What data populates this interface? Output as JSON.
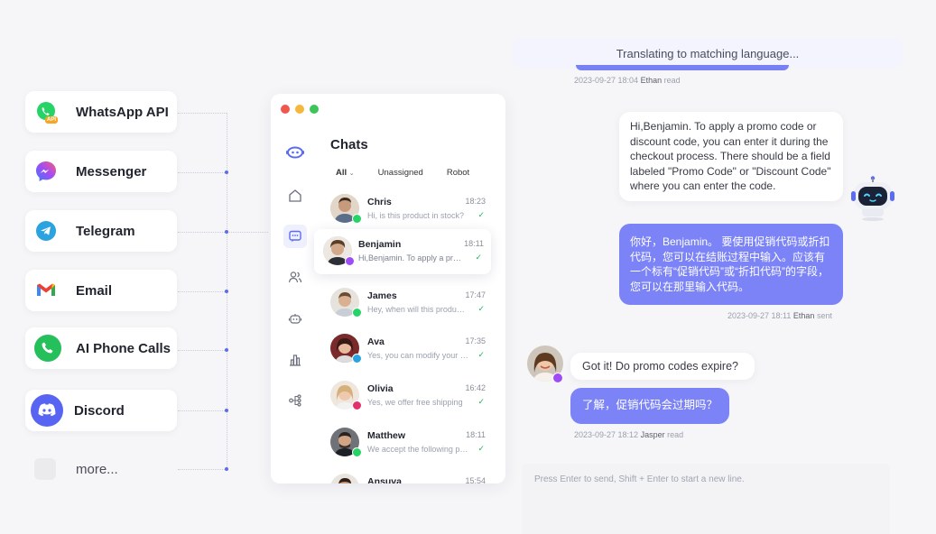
{
  "channels": [
    {
      "label": "WhatsApp API",
      "icon": "whatsapp-icon",
      "badge": "API"
    },
    {
      "label": "Messenger",
      "icon": "messenger-icon"
    },
    {
      "label": "Telegram",
      "icon": "telegram-icon"
    },
    {
      "label": "Email",
      "icon": "gmail-icon"
    },
    {
      "label": "AI Phone Calls",
      "icon": "phone-icon"
    },
    {
      "label": "Discord",
      "icon": "discord-icon"
    },
    {
      "label": "more...",
      "icon": "more-icon"
    }
  ],
  "window": {
    "traffic_colors": [
      "#f0584f",
      "#f5b83a",
      "#3dc55a"
    ],
    "rail_icons": [
      "logo-icon",
      "home-icon",
      "chat-icon",
      "contacts-icon",
      "bot-icon",
      "analytics-icon",
      "flow-icon"
    ],
    "chats_title": "Chats",
    "filters": [
      "All",
      "Unassigned",
      "Robot"
    ],
    "chats": [
      {
        "name": "Chris",
        "time": "18:23",
        "preview": "Hi, is this product in stock?",
        "channel": "whatsapp",
        "check": "✓"
      },
      {
        "name": "Benjamin",
        "time": "18:11",
        "preview": "Hi,Benjamin. To apply a promo code",
        "channel": "messenger",
        "check": "✓"
      },
      {
        "name": "James",
        "time": "17:47",
        "preview": "Hey, when will this product ship?",
        "channel": "whatsapp",
        "check": "✓"
      },
      {
        "name": "Ava",
        "time": "17:35",
        "preview": "Yes, you can modify your order",
        "channel": "telegram",
        "check": "✓"
      },
      {
        "name": "Olivia",
        "time": "16:42",
        "preview": "Yes, we offer free shipping",
        "channel": "instagram",
        "check": "✓"
      },
      {
        "name": "Matthew",
        "time": "18:11",
        "preview": "We accept the following payments",
        "channel": "whatsapp",
        "check": "✓"
      },
      {
        "name": "Ansuva",
        "time": "15:54",
        "preview": "",
        "channel": "",
        "check": ""
      }
    ]
  },
  "conversation": {
    "translating": "Translating to matching language...",
    "meta1": {
      "time": "2023-09-27 18:04",
      "who": "Ethan",
      "status": "read"
    },
    "bot_message": "Hi,Benjamin. To apply a promo code or discount code, you can enter it during the checkout process. There should be a field labeled \"Promo Code\" or \"Discount Code\" where you can enter the code.",
    "translated_message": "你好，Benjamin。 要使用促销代码或折扣代码，您可以在结账过程中输入。应该有一个标有“促销代码”或“折扣代码”的字段，您可以在那里输入代码。",
    "meta2": {
      "time": "2023-09-27 18:11",
      "who": "Ethan",
      "status": "sent"
    },
    "customer_message": "Got it! Do promo codes expire?",
    "customer_translated": "了解，促销代码会过期吗？",
    "meta3": {
      "time": "2023-09-27 18:12",
      "who": "Jasper",
      "status": "read"
    },
    "input_placeholder": "Press Enter to send,  Shift + Enter to start a new line."
  },
  "colors": {
    "accent": "#7b83f6",
    "whatsapp": "#25d366",
    "messenger": "#a04cf5",
    "telegram": "#2aa3e0",
    "discord": "#5865f2"
  }
}
